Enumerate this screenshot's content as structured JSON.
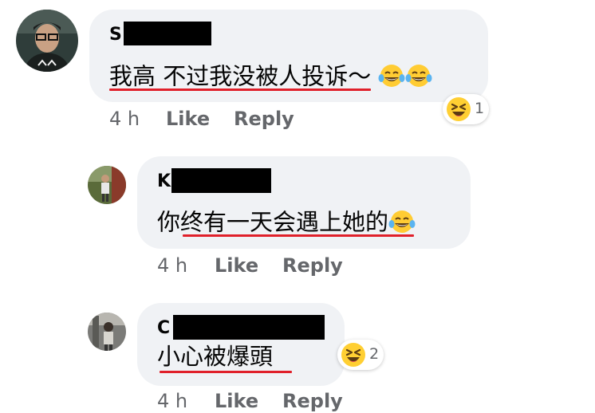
{
  "comments": [
    {
      "author_initial": "S",
      "text": "我高 不过我没被人投诉～",
      "inline_emoji": [
        "tears-of-joy-emoji",
        "tears-of-joy-emoji"
      ],
      "time": "4 h",
      "like_label": "Like",
      "reply_label": "Reply",
      "reaction": {
        "icon": "laughing-emoji",
        "count": "1"
      }
    },
    {
      "author_initial": "K",
      "text": "你终有一天会遇上她的",
      "inline_emoji": [
        "tears-of-joy-emoji"
      ],
      "time": "4 h",
      "like_label": "Like",
      "reply_label": "Reply"
    },
    {
      "author_initial": "C",
      "text": "小心被爆頭",
      "time": "4 h",
      "like_label": "Like",
      "reply_label": "Reply",
      "reaction": {
        "icon": "laughing-emoji",
        "count": "2"
      }
    }
  ],
  "colors": {
    "bubble": "#f0f2f5",
    "meta_text": "#65676b",
    "annotation_underline": "#e0202a",
    "redaction": "#000000"
  }
}
